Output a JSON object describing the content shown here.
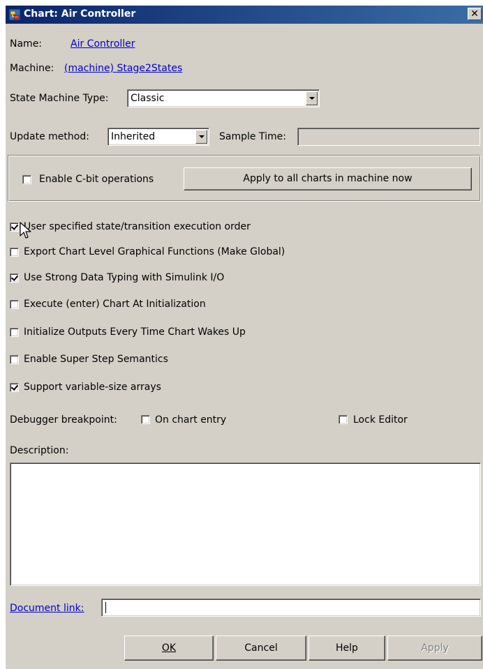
{
  "window": {
    "title": "Chart: Air Controller",
    "close_glyph": "✕",
    "icon": "stateflow-chart-icon"
  },
  "name": {
    "label": "Name:",
    "value": "Air Controller"
  },
  "machine": {
    "label": "Machine:",
    "value": "(machine) Stage2States"
  },
  "state_machine_type": {
    "label": "State Machine Type:",
    "value": "Classic"
  },
  "update_method": {
    "label": "Update method:",
    "value": "Inherited"
  },
  "sample_time": {
    "label": "Sample Time:",
    "value": ""
  },
  "cbit": {
    "enable_label": "Enable C-bit operations",
    "enable_checked": false,
    "apply_all_label": "Apply to all charts in machine now"
  },
  "options": [
    {
      "label": "User specified state/transition execution order",
      "checked": true
    },
    {
      "label": "Export Chart Level Graphical Functions (Make Global)",
      "checked": false
    },
    {
      "label": "Use Strong Data Typing with Simulink I/O",
      "checked": true
    },
    {
      "label": "Execute (enter) Chart At Initialization",
      "checked": false
    },
    {
      "label": "Initialize Outputs Every Time Chart Wakes Up",
      "checked": false
    },
    {
      "label": "Enable Super Step Semantics",
      "checked": false
    },
    {
      "label": "Support variable-size arrays",
      "checked": true
    }
  ],
  "debugger": {
    "label": "Debugger breakpoint:",
    "on_entry_label": "On chart entry",
    "on_entry_checked": false,
    "lock_editor_label": "Lock Editor",
    "lock_editor_checked": false
  },
  "description": {
    "label": "Description:",
    "value": ""
  },
  "document_link": {
    "label": "Document link:",
    "value": ""
  },
  "buttons": {
    "ok": "OK",
    "cancel": "Cancel",
    "help": "Help",
    "apply": "Apply"
  },
  "colors": {
    "dialog_bg": "#d4d0c8",
    "titlebar_start": "#0a246a",
    "titlebar_end": "#3a6ea5",
    "link": "#0000cc"
  }
}
